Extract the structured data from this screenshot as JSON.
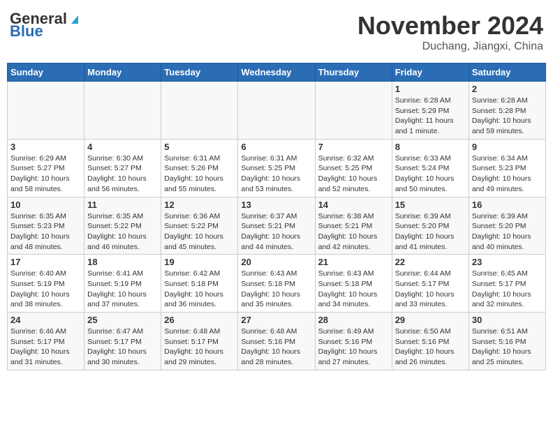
{
  "header": {
    "logo_general": "General",
    "logo_blue": "Blue",
    "month": "November 2024",
    "location": "Duchang, Jiangxi, China"
  },
  "weekdays": [
    "Sunday",
    "Monday",
    "Tuesday",
    "Wednesday",
    "Thursday",
    "Friday",
    "Saturday"
  ],
  "weeks": [
    [
      {
        "day": "",
        "info": ""
      },
      {
        "day": "",
        "info": ""
      },
      {
        "day": "",
        "info": ""
      },
      {
        "day": "",
        "info": ""
      },
      {
        "day": "",
        "info": ""
      },
      {
        "day": "1",
        "info": "Sunrise: 6:28 AM\nSunset: 5:29 PM\nDaylight: 11 hours and 1 minute."
      },
      {
        "day": "2",
        "info": "Sunrise: 6:28 AM\nSunset: 5:28 PM\nDaylight: 10 hours and 59 minutes."
      }
    ],
    [
      {
        "day": "3",
        "info": "Sunrise: 6:29 AM\nSunset: 5:27 PM\nDaylight: 10 hours and 58 minutes."
      },
      {
        "day": "4",
        "info": "Sunrise: 6:30 AM\nSunset: 5:27 PM\nDaylight: 10 hours and 56 minutes."
      },
      {
        "day": "5",
        "info": "Sunrise: 6:31 AM\nSunset: 5:26 PM\nDaylight: 10 hours and 55 minutes."
      },
      {
        "day": "6",
        "info": "Sunrise: 6:31 AM\nSunset: 5:25 PM\nDaylight: 10 hours and 53 minutes."
      },
      {
        "day": "7",
        "info": "Sunrise: 6:32 AM\nSunset: 5:25 PM\nDaylight: 10 hours and 52 minutes."
      },
      {
        "day": "8",
        "info": "Sunrise: 6:33 AM\nSunset: 5:24 PM\nDaylight: 10 hours and 50 minutes."
      },
      {
        "day": "9",
        "info": "Sunrise: 6:34 AM\nSunset: 5:23 PM\nDaylight: 10 hours and 49 minutes."
      }
    ],
    [
      {
        "day": "10",
        "info": "Sunrise: 6:35 AM\nSunset: 5:23 PM\nDaylight: 10 hours and 48 minutes."
      },
      {
        "day": "11",
        "info": "Sunrise: 6:35 AM\nSunset: 5:22 PM\nDaylight: 10 hours and 46 minutes."
      },
      {
        "day": "12",
        "info": "Sunrise: 6:36 AM\nSunset: 5:22 PM\nDaylight: 10 hours and 45 minutes."
      },
      {
        "day": "13",
        "info": "Sunrise: 6:37 AM\nSunset: 5:21 PM\nDaylight: 10 hours and 44 minutes."
      },
      {
        "day": "14",
        "info": "Sunrise: 6:38 AM\nSunset: 5:21 PM\nDaylight: 10 hours and 42 minutes."
      },
      {
        "day": "15",
        "info": "Sunrise: 6:39 AM\nSunset: 5:20 PM\nDaylight: 10 hours and 41 minutes."
      },
      {
        "day": "16",
        "info": "Sunrise: 6:39 AM\nSunset: 5:20 PM\nDaylight: 10 hours and 40 minutes."
      }
    ],
    [
      {
        "day": "17",
        "info": "Sunrise: 6:40 AM\nSunset: 5:19 PM\nDaylight: 10 hours and 38 minutes."
      },
      {
        "day": "18",
        "info": "Sunrise: 6:41 AM\nSunset: 5:19 PM\nDaylight: 10 hours and 37 minutes."
      },
      {
        "day": "19",
        "info": "Sunrise: 6:42 AM\nSunset: 5:18 PM\nDaylight: 10 hours and 36 minutes."
      },
      {
        "day": "20",
        "info": "Sunrise: 6:43 AM\nSunset: 5:18 PM\nDaylight: 10 hours and 35 minutes."
      },
      {
        "day": "21",
        "info": "Sunrise: 6:43 AM\nSunset: 5:18 PM\nDaylight: 10 hours and 34 minutes."
      },
      {
        "day": "22",
        "info": "Sunrise: 6:44 AM\nSunset: 5:17 PM\nDaylight: 10 hours and 33 minutes."
      },
      {
        "day": "23",
        "info": "Sunrise: 6:45 AM\nSunset: 5:17 PM\nDaylight: 10 hours and 32 minutes."
      }
    ],
    [
      {
        "day": "24",
        "info": "Sunrise: 6:46 AM\nSunset: 5:17 PM\nDaylight: 10 hours and 31 minutes."
      },
      {
        "day": "25",
        "info": "Sunrise: 6:47 AM\nSunset: 5:17 PM\nDaylight: 10 hours and 30 minutes."
      },
      {
        "day": "26",
        "info": "Sunrise: 6:48 AM\nSunset: 5:17 PM\nDaylight: 10 hours and 29 minutes."
      },
      {
        "day": "27",
        "info": "Sunrise: 6:48 AM\nSunset: 5:16 PM\nDaylight: 10 hours and 28 minutes."
      },
      {
        "day": "28",
        "info": "Sunrise: 6:49 AM\nSunset: 5:16 PM\nDaylight: 10 hours and 27 minutes."
      },
      {
        "day": "29",
        "info": "Sunrise: 6:50 AM\nSunset: 5:16 PM\nDaylight: 10 hours and 26 minutes."
      },
      {
        "day": "30",
        "info": "Sunrise: 6:51 AM\nSunset: 5:16 PM\nDaylight: 10 hours and 25 minutes."
      }
    ]
  ]
}
